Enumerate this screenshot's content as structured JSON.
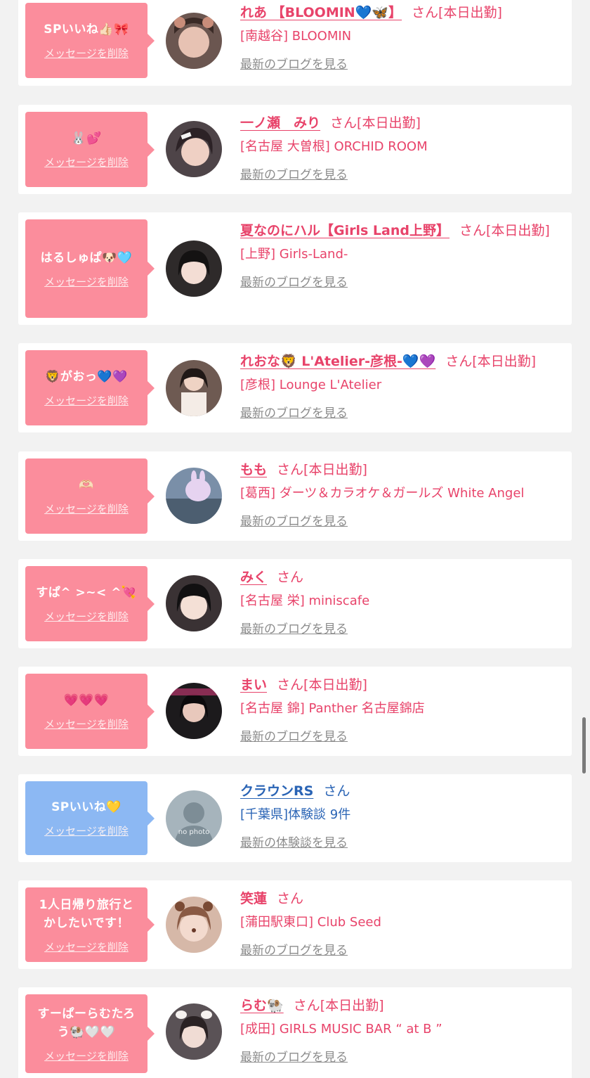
{
  "common": {
    "delete_label": "メッセージを削除"
  },
  "colors": {
    "pink_bubble": "#fb8d9c",
    "blue_bubble": "#8cb8f3",
    "name_pink": "#e8436a",
    "name_blue": "#2a64b5",
    "link_gray": "#8c8c8c"
  },
  "items": [
    {
      "message": "SPいいね👍🏻🎀",
      "name": "れあ 【BLOOMIN💙🦋】",
      "suffix": "さん",
      "status": "[本日出勤]",
      "shop": "[南越谷] BLOOMIN",
      "link": "最新のブログを見る",
      "theme": "pink"
    },
    {
      "message": "🐰💕",
      "name": "一ノ瀬　みり",
      "suffix": "さん",
      "status": "[本日出勤]",
      "shop": "[名古屋 大曽根] ORCHID ROOM",
      "link": "最新のブログを見る",
      "theme": "pink"
    },
    {
      "message": "はるしゅぱ🐶🩵",
      "name": "夏なのにハル【Girls Land上野】",
      "suffix": "さん",
      "status": "[本日出勤]",
      "shop": "[上野] Girls-Land-",
      "link": "最新のブログを見る",
      "theme": "pink"
    },
    {
      "message": "🦁がおっ💙💜",
      "name": "れおな🦁 L'Atelier-彦根-💙💜",
      "suffix": "さん",
      "status": "[本日出勤]",
      "shop": "[彦根] Lounge L'Atelier",
      "link": "最新のブログを見る",
      "theme": "pink"
    },
    {
      "message": "🫶🏻",
      "name": "もも",
      "suffix": "さん",
      "status": "[本日出勤]",
      "shop": "[葛西] ダーツ＆カラオケ＆ガールズ White Angel",
      "link": "最新のブログを見る",
      "theme": "pink"
    },
    {
      "message": "すぱ^ >~< ^💘",
      "name": "みく",
      "suffix": "さん",
      "status": "",
      "shop": "[名古屋 栄] miniscafe",
      "link": "最新のブログを見る",
      "theme": "pink"
    },
    {
      "message": "💗💗💗",
      "name": "まい",
      "suffix": "さん",
      "status": "[本日出勤]",
      "shop": "[名古屋 錦] Panther 名古屋錦店",
      "link": "最新のブログを見る",
      "theme": "pink"
    },
    {
      "message": "SPいいね💛",
      "name": "クラウンRS",
      "suffix": "さん",
      "status": "",
      "shop": "[千葉県]体験談 9件",
      "link": "最新の体験談を見る",
      "theme": "blue",
      "avatar_text": "no photo"
    },
    {
      "message": "1人日帰り旅行とかしたいです！",
      "name": "笑蓮",
      "suffix": "さん",
      "status": "",
      "shop": "[蒲田駅東口] Club Seed",
      "link": "最新のブログを見る",
      "theme": "pink"
    },
    {
      "message": "すーぱーらむたろう🐏🤍🤍",
      "name": "らむ🐏",
      "suffix": "さん",
      "status": "[本日出勤]",
      "shop": "[成田] GIRLS MUSIC BAR “ at B ”",
      "link": "最新のブログを見る",
      "theme": "pink"
    }
  ]
}
